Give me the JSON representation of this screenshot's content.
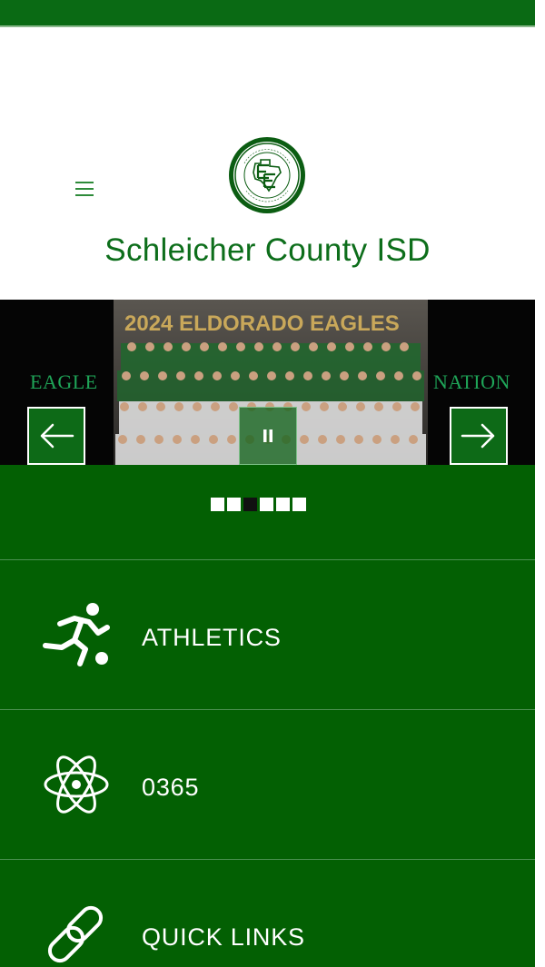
{
  "header": {
    "site_title": "Schleicher County ISD",
    "menu_icon": "hamburger-menu-icon",
    "logo_icon": "district-seal-logo"
  },
  "slider": {
    "photo_caption": "2024 ELDORADO EAGLES",
    "left_text": "EAGLE",
    "right_text": "NATION",
    "prev_icon": "arrow-left-icon",
    "next_icon": "arrow-right-icon",
    "pause_icon": "pause-icon",
    "slide_count": 6,
    "active_slide": 3
  },
  "nav": {
    "items": [
      {
        "label": "ATHLETICS",
        "icon": "athlete-running-icon"
      },
      {
        "label": "0365",
        "icon": "atom-icon"
      },
      {
        "label": "QUICK LINKS",
        "icon": "chain-link-icon"
      }
    ]
  },
  "colors": {
    "brand_green": "#036003",
    "title_green": "#0d6e1b",
    "side_text_green": "#1fa558",
    "white": "#ffffff"
  }
}
